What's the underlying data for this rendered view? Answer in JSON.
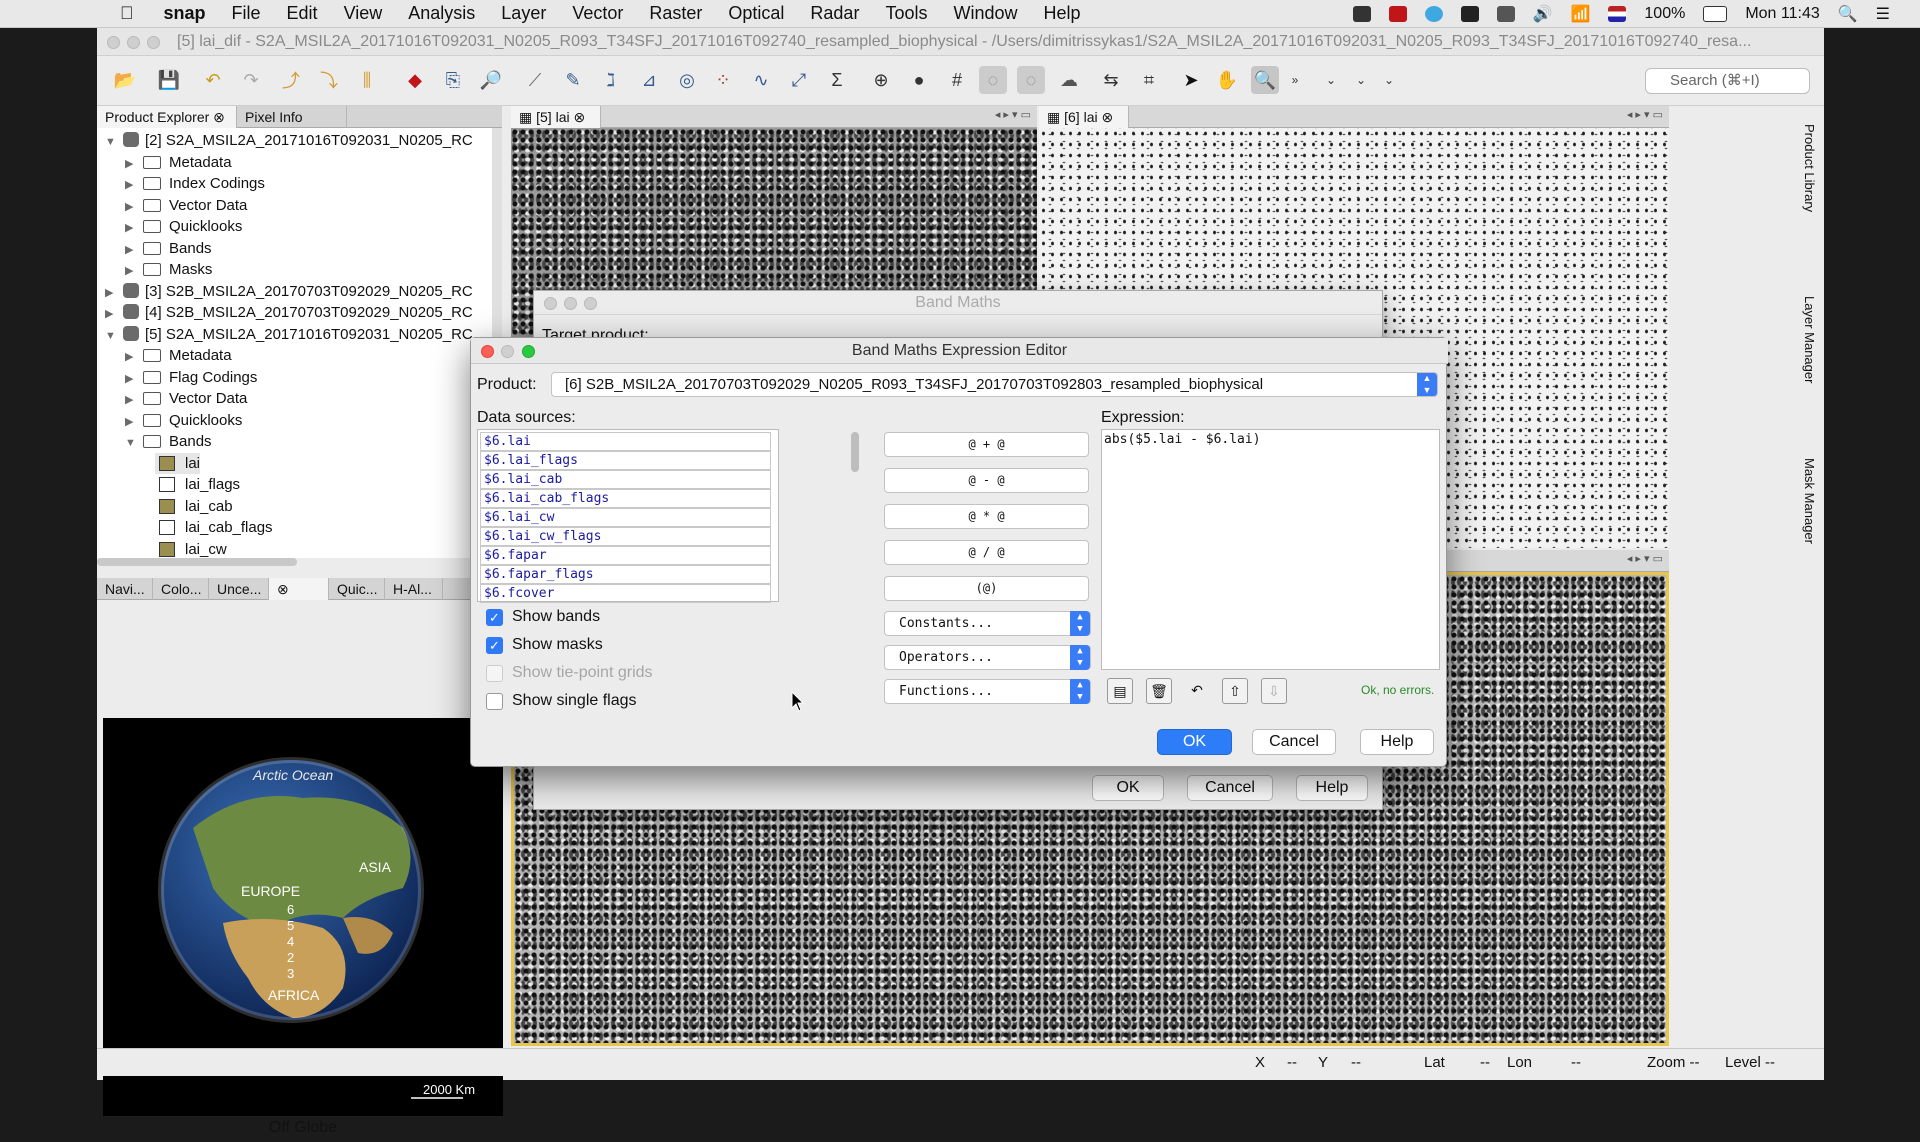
{
  "menubar": {
    "apple": "",
    "app": "snap",
    "items": [
      "File",
      "Edit",
      "View",
      "Analysis",
      "Layer",
      "Vector",
      "Raster",
      "Optical",
      "Radar",
      "Tools",
      "Window",
      "Help"
    ],
    "battery": "100%",
    "clock": "Mon 11:43"
  },
  "window": {
    "title": "[5] lai_dif - S2A_MSIL2A_20171016T092031_N0205_R093_T34SFJ_20171016T092740_resampled_biophysical - /Users/dimitrissykas1/S2A_MSIL2A_20171016T092031_N0205_R093_T34SFJ_20171016T092740_resa..."
  },
  "toolbar": {
    "search_placeholder": "Search (⌘+I)"
  },
  "leftpanel": {
    "tabs": [
      "Product Explorer",
      "Pixel Info"
    ],
    "tree": [
      {
        "label": "[2] S2A_MSIL2A_20171016T092031_N0205_RC",
        "kind": "product",
        "open": true
      },
      {
        "label": "Metadata",
        "kind": "folder"
      },
      {
        "label": "Index Codings",
        "kind": "folder"
      },
      {
        "label": "Vector Data",
        "kind": "folder"
      },
      {
        "label": "Quicklooks",
        "kind": "folder"
      },
      {
        "label": "Bands",
        "kind": "folder"
      },
      {
        "label": "Masks",
        "kind": "folder"
      },
      {
        "label": "[3] S2B_MSIL2A_20170703T092029_N0205_RC",
        "kind": "product",
        "open": false
      },
      {
        "label": "[4] S2B_MSIL2A_20170703T092029_N0205_RC",
        "kind": "product",
        "open": false
      },
      {
        "label": "[5] S2A_MSIL2A_20171016T092031_N0205_RC",
        "kind": "product",
        "open": true
      },
      {
        "label": "Metadata",
        "kind": "folder"
      },
      {
        "label": "Flag Codings",
        "kind": "folder"
      },
      {
        "label": "Vector Data",
        "kind": "folder"
      },
      {
        "label": "Quicklooks",
        "kind": "folder"
      },
      {
        "label": "Bands",
        "kind": "folder",
        "open": true
      },
      {
        "label": "lai",
        "kind": "band"
      },
      {
        "label": "lai_flags",
        "kind": "flag"
      },
      {
        "label": "lai_cab",
        "kind": "band"
      },
      {
        "label": "lai_cab_flags",
        "kind": "flag"
      },
      {
        "label": "lai_cw",
        "kind": "band"
      }
    ],
    "bottom_tabs": [
      "Navi...",
      "Colo...",
      "Unce...",
      "Quic...",
      "H-Al..."
    ],
    "globe": {
      "ocean": "Arctic Ocean",
      "europe": "EUROPE",
      "asia": "ASIA",
      "africa": "AFRICA",
      "scale": "2000 Km",
      "numbers": [
        "6",
        "5",
        "4",
        "2",
        "3"
      ],
      "mode_button": "Off Globe"
    }
  },
  "views": {
    "tab1": "[5] lai",
    "tab2": "[6] lai"
  },
  "right_tabs": [
    "Product Library",
    "Layer Manager",
    "Mask Manager"
  ],
  "statusbar": {
    "x": "X",
    "x_val": "--",
    "y": "Y",
    "y_val": "--",
    "lat": "Lat",
    "lat_val": "--",
    "lon": "Lon",
    "lon_val": "--",
    "zoom": "Zoom --",
    "level": "Level --"
  },
  "band_maths": {
    "title": "Band Maths",
    "target": "Target product:",
    "ok": "OK",
    "cancel": "Cancel",
    "help": "Help"
  },
  "editor": {
    "title": "Band Maths Expression Editor",
    "product_label": "Product:",
    "product_value": "[6] S2B_MSIL2A_20170703T092029_N0205_R093_T34SFJ_20170703T092803_resampled_biophysical",
    "data_sources_label": "Data sources:",
    "data_sources": [
      "$6.lai",
      "$6.lai_flags",
      "$6.lai_cab",
      "$6.lai_cab_flags",
      "$6.lai_cw",
      "$6.lai_cw_flags",
      "$6.fapar",
      "$6.fapar_flags",
      "$6.fcover"
    ],
    "operators": [
      "@ + @",
      "@ - @",
      "@ * @",
      "@ / @",
      "(@)"
    ],
    "combos": [
      "Constants...",
      "Operators...",
      "Functions..."
    ],
    "checks": [
      {
        "label": "Show bands",
        "state": "on"
      },
      {
        "label": "Show masks",
        "state": "on"
      },
      {
        "label": "Show tie-point grids",
        "state": "disabled"
      },
      {
        "label": "Show single flags",
        "state": "off"
      }
    ],
    "expression_label": "Expression:",
    "expression": "abs($5.lai - $6.lai)",
    "status": "Ok, no errors.",
    "ok": "OK",
    "cancel": "Cancel",
    "help": "Help"
  }
}
